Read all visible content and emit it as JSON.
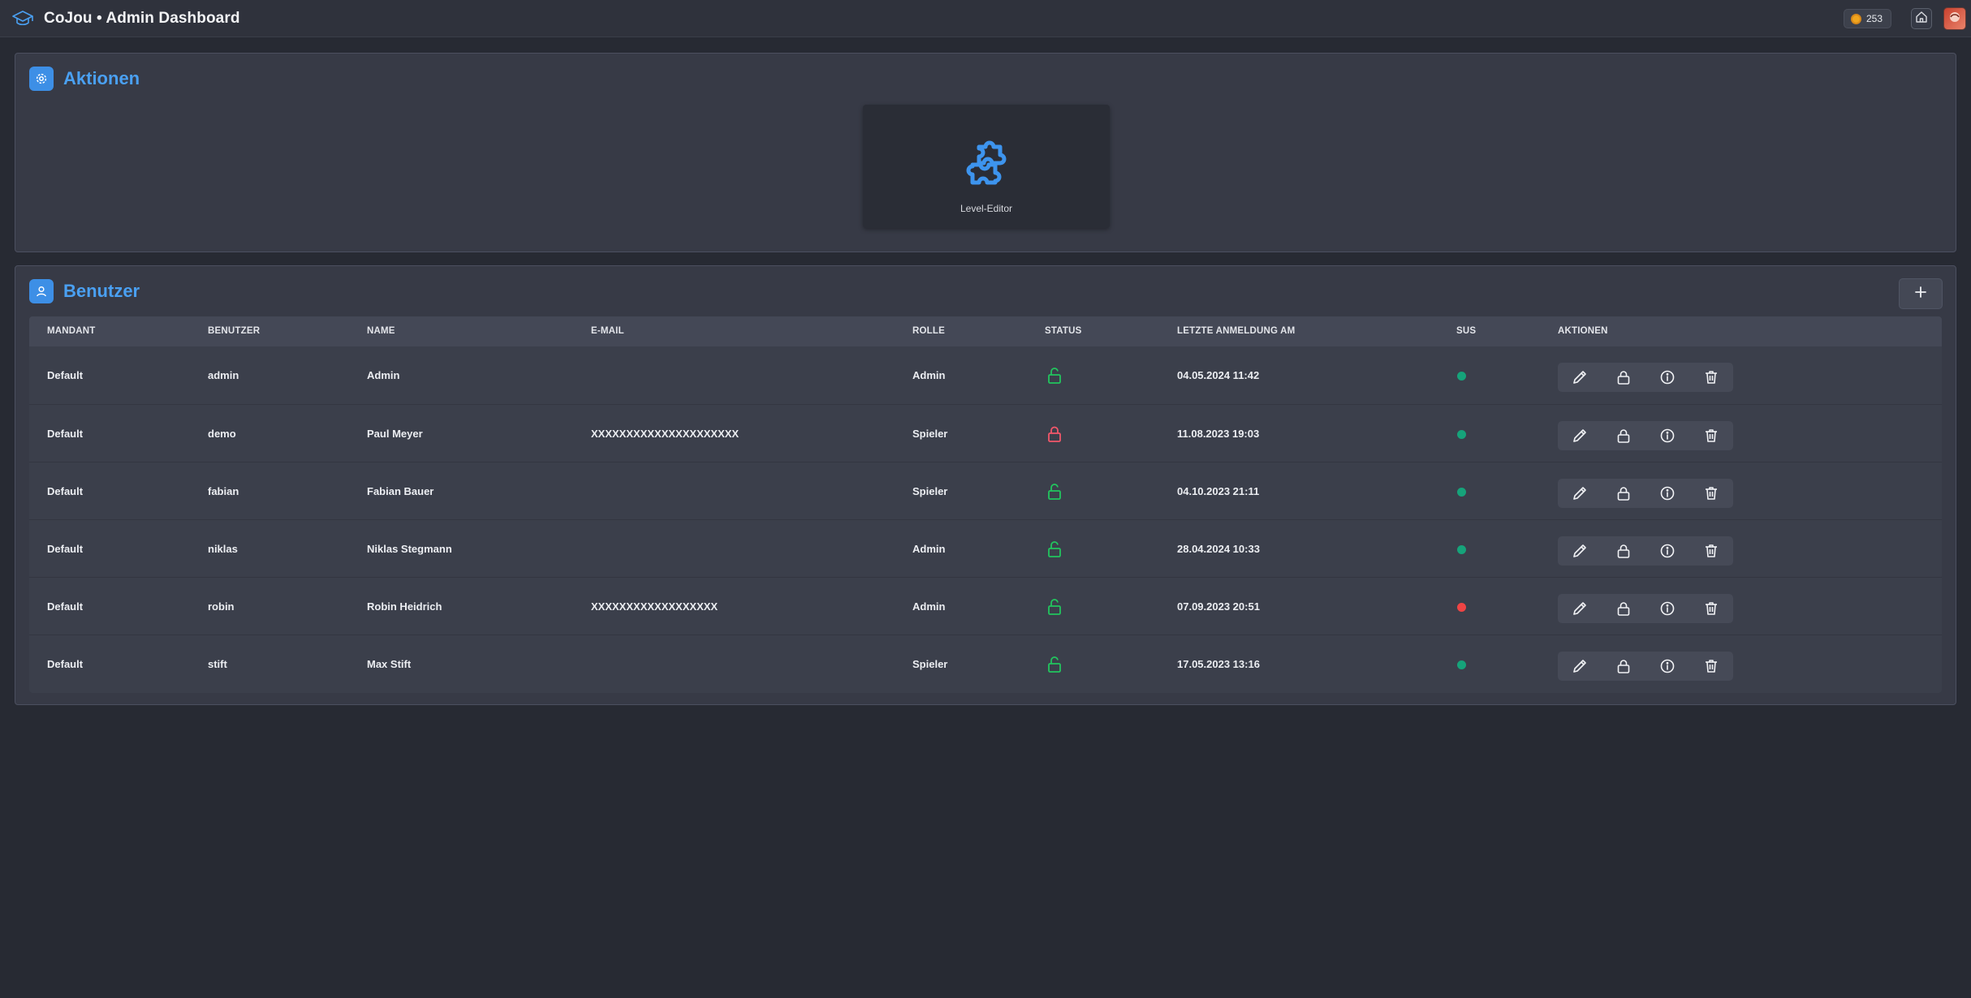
{
  "app": {
    "title": "CoJou • Admin Dashboard",
    "coins": "253"
  },
  "colors": {
    "accent": "#4aa0f2",
    "status_open": "#22c55e",
    "status_locked": "#f2576a",
    "sus_ok": "#16a37a",
    "sus_bad": "#ef4444"
  },
  "actions": {
    "title": "Aktionen",
    "card_label": "Level-Editor",
    "card_icon": "puzzle-icon"
  },
  "users": {
    "title": "Benutzer",
    "columns": [
      "MANDANT",
      "BENUTZER",
      "NAME",
      "E-MAIL",
      "ROLLE",
      "STATUS",
      "LETZTE ANMELDUNG AM",
      "SUS",
      "AKTIONEN"
    ],
    "rows": [
      {
        "mandant": "Default",
        "benutzer": "admin",
        "name": "Admin",
        "email": "",
        "rolle": "Admin",
        "status": "unlocked",
        "last_login": "04.05.2024 11:42",
        "sus": "ok"
      },
      {
        "mandant": "Default",
        "benutzer": "demo",
        "name": "Paul Meyer",
        "email": "XXXXXXXXXXXXXXXXXXXXX",
        "rolle": "Spieler",
        "status": "locked",
        "last_login": "11.08.2023 19:03",
        "sus": "ok"
      },
      {
        "mandant": "Default",
        "benutzer": "fabian",
        "name": "Fabian Bauer",
        "email": "",
        "rolle": "Spieler",
        "status": "unlocked",
        "last_login": "04.10.2023 21:11",
        "sus": "ok"
      },
      {
        "mandant": "Default",
        "benutzer": "niklas",
        "name": "Niklas Stegmann",
        "email": "",
        "rolle": "Admin",
        "status": "unlocked",
        "last_login": "28.04.2024 10:33",
        "sus": "ok"
      },
      {
        "mandant": "Default",
        "benutzer": "robin",
        "name": "Robin Heidrich",
        "email": "XXXXXXXXXXXXXXXXXX",
        "rolle": "Admin",
        "status": "unlocked",
        "last_login": "07.09.2023 20:51",
        "sus": "bad"
      },
      {
        "mandant": "Default",
        "benutzer": "stift",
        "name": "Max Stift",
        "email": "",
        "rolle": "Spieler",
        "status": "unlocked",
        "last_login": "17.05.2023 13:16",
        "sus": "ok"
      }
    ]
  }
}
